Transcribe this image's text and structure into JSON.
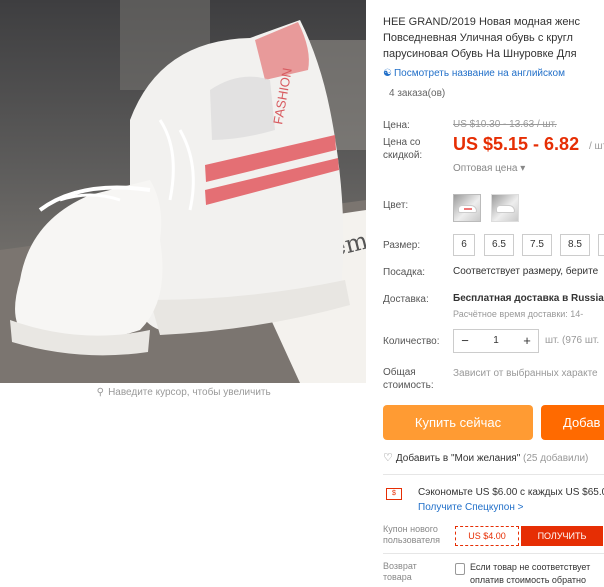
{
  "product": {
    "title_line1": "HEE GRAND/2019 Новая модная женс",
    "title_line2": "Повседневная Уличная обувь с кругл",
    "title_line3": "парусиновая Обувь На Шнуровке Для",
    "translate_link": "Посмотреть название на английском",
    "orders": "4 заказа(ов)",
    "image_text_fashion": "FASHION",
    "image_text_box": "Decem",
    "zoom_hint": "Наведите курсор, чтобы увеличить"
  },
  "pricing": {
    "price_label": "Цена:",
    "old_price": "US $10.30 - 13.63 / шт.",
    "discount_label_1": "Цена со",
    "discount_label_2": "скидкой:",
    "price": "US $5.15 - 6.82",
    "unit": "/ шт",
    "wholesale": "Оптовая цена ▾"
  },
  "options": {
    "color_label": "Цвет:",
    "size_label": "Размер:",
    "sizes": [
      "6",
      "6.5",
      "7.5",
      "8.5"
    ],
    "fit_label": "Посадка:",
    "fit_value": "Соответствует размеру, берите",
    "shipping_label": "Доставка:",
    "shipping_value": "Бесплатная доставка в Russia",
    "shipping_time": "Расчётное время доставки: 14-",
    "qty_label": "Количество:",
    "qty_value": "1",
    "qty_available": "шт. (976 шт.",
    "total_label_1": "Общая",
    "total_label_2": "стоимость:",
    "total_value": "Зависит от выбранных характе"
  },
  "actions": {
    "buy_now": "Купить сейчас",
    "add_to_cart": "Добав",
    "wishlist": "Добавить в \"Мои желания\"",
    "wishlist_count": "(25 добавили)"
  },
  "promo": {
    "save_text": "Сэкономьте US $6.00 с каждых US $65.0",
    "promo_link": "Получите Спецкупон >",
    "coupon_label_1": "Купон нового",
    "coupon_label_2": "пользователя",
    "coupon_value": "US $4.00",
    "get_button": "ПОЛУЧИТЬ",
    "return_label_1": "Возврат",
    "return_label_2": "товара",
    "return_text_1": "Если товар не соответствует",
    "return_text_2": "оплатив стоимость обратно"
  },
  "colors": {
    "price_red": "#e62e04",
    "buy_now_orange": "#ff9b33",
    "cart_orange": "#ff6a00",
    "link_blue": "#2270c9"
  }
}
